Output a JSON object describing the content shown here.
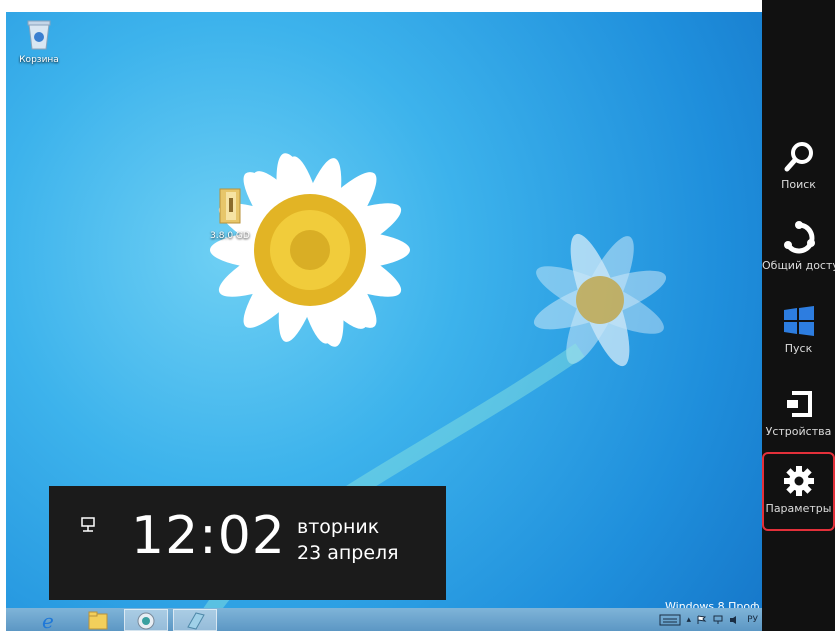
{
  "desktop": {
    "icons": [
      {
        "label": "Корзина"
      },
      {
        "label": "3.8.0 GD"
      }
    ],
    "watermark": "Windows 8 Проф"
  },
  "clock": {
    "time": "12:02",
    "day": "вторник",
    "date": "23 апреля"
  },
  "charms": [
    {
      "label": "Поиск",
      "icon": "search-icon"
    },
    {
      "label": "Общий досту",
      "icon": "share-icon"
    },
    {
      "label": "Пуск",
      "icon": "windows-start-icon"
    },
    {
      "label": "Устройства",
      "icon": "devices-icon"
    },
    {
      "label": "Параметры",
      "icon": "settings-gear-icon"
    }
  ],
  "taskbar": {
    "tray_language": "РУ"
  },
  "colors": {
    "charms_bg": "#111111",
    "highlight": "#e3303a",
    "start_tile": "#2d7de0"
  }
}
